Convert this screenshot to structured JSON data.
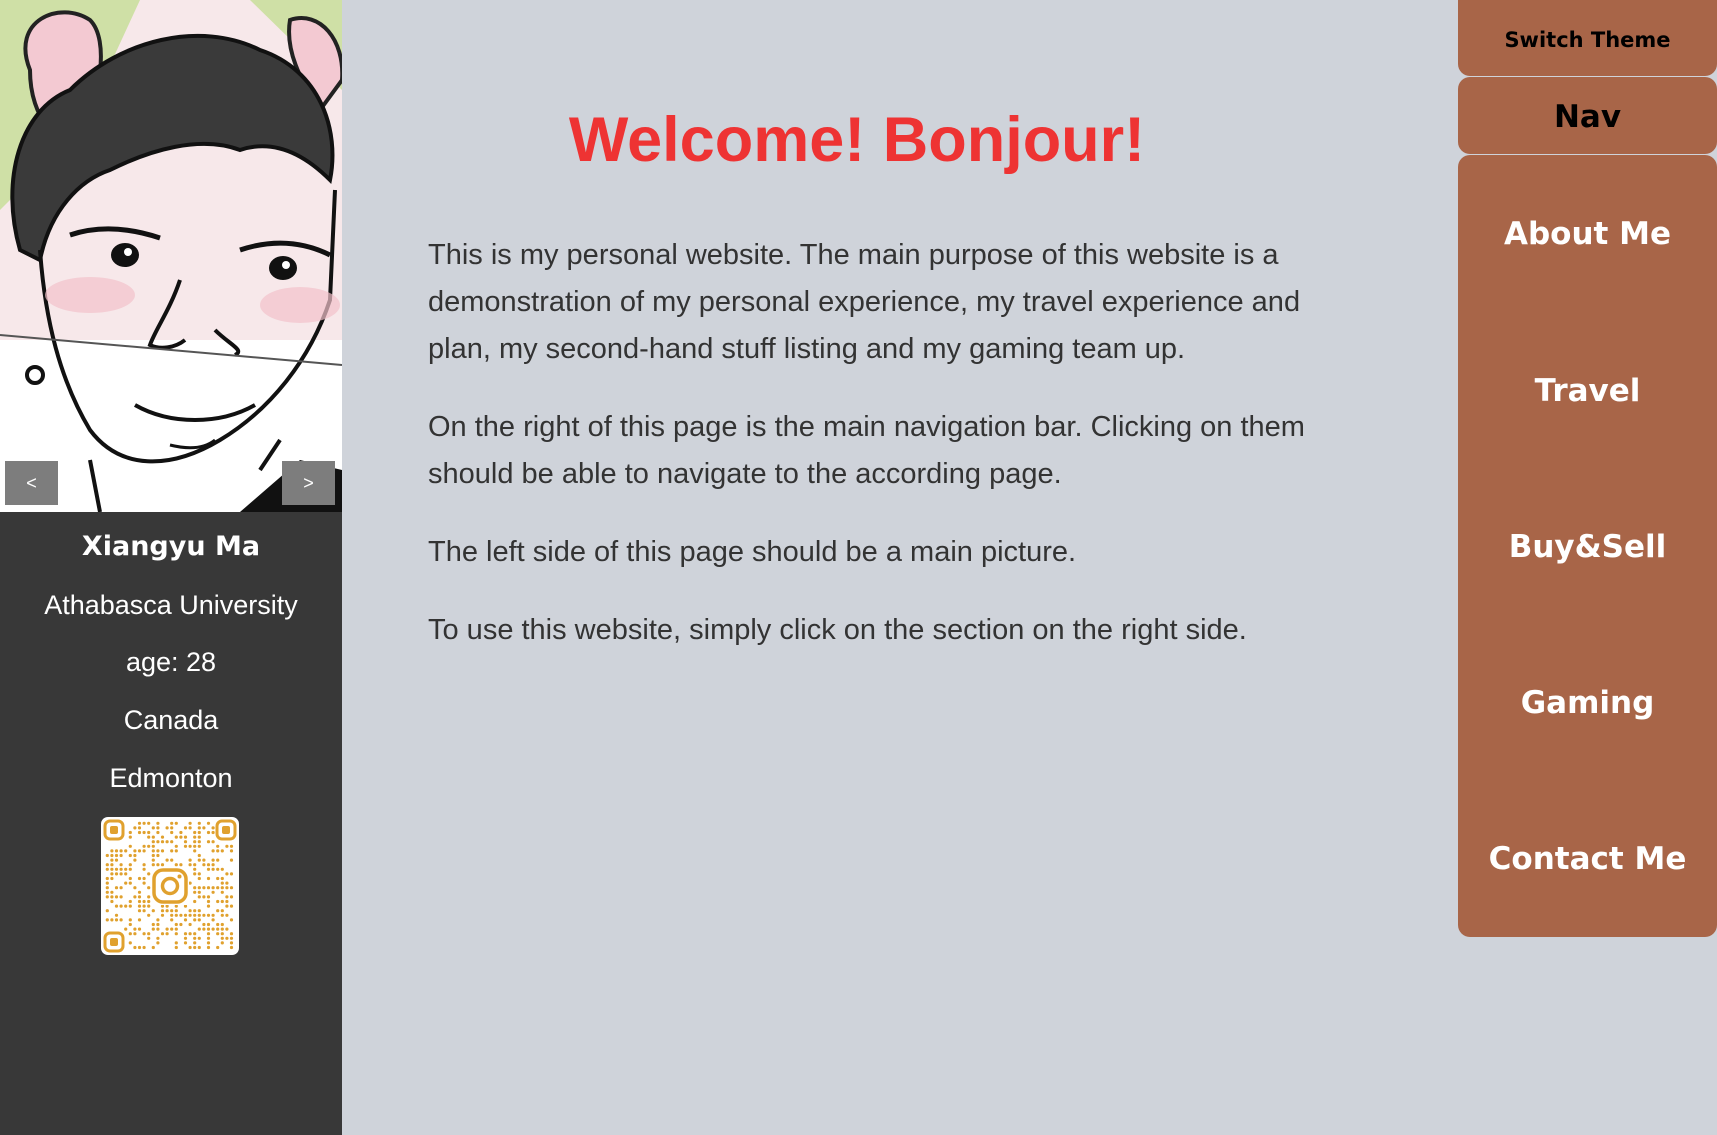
{
  "theme": {
    "background": "#cfd3da",
    "sidebar_background": "#383838",
    "accent": "#a86548",
    "heading_color": "#ee3333",
    "qr_color": "#e0a12e"
  },
  "carousel": {
    "prev_label": "<",
    "next_label": ">"
  },
  "profile": {
    "name": "Xiangyu Ma",
    "university": "Athabasca University",
    "age": "age: 28",
    "country": "Canada",
    "city": "Edmonton",
    "qr_icon": "instagram-icon"
  },
  "main": {
    "heading": "Welcome! Bonjour!",
    "paragraphs": [
      "This is my personal website. The main purpose of this website is a demonstration of my personal experience, my travel experience and plan, my second-hand stuff listing and my gaming team up.",
      "On the right of this page is the main navigation bar. Clicking on them should be able to navigate to the according page.",
      "The left side of this page should be a main picture.",
      "To use this website, simply click on the section on the right side."
    ]
  },
  "nav": {
    "switch_theme": "Switch Theme",
    "title": "Nav",
    "items": [
      {
        "label": "About Me"
      },
      {
        "label": "Travel"
      },
      {
        "label": "Buy&Sell"
      },
      {
        "label": "Gaming"
      },
      {
        "label": "Contact Me"
      }
    ]
  }
}
